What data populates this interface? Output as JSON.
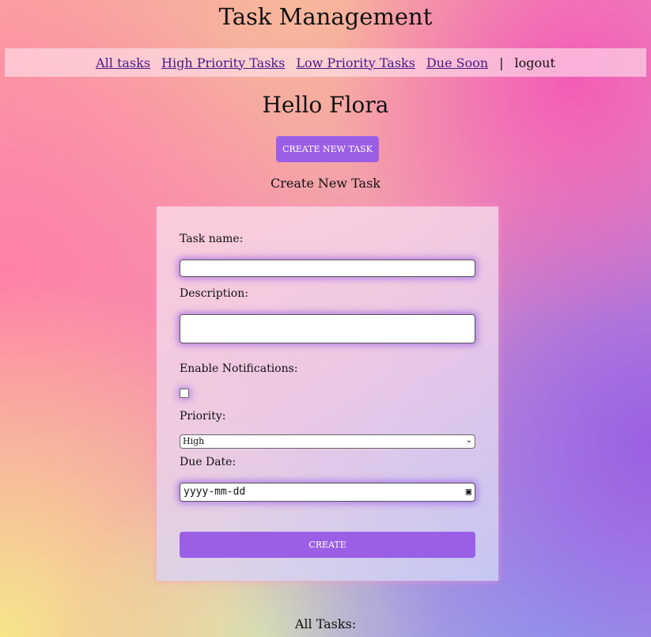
{
  "header": {
    "title": "Task Management"
  },
  "nav": {
    "links": [
      "All tasks",
      "High Priority Tasks",
      "Low Priority Tasks",
      "Due Soon"
    ],
    "separator": "|",
    "logout": "logout"
  },
  "greeting": "Hello Flora",
  "create_new_task_button": "CREATE NEW TASK",
  "form": {
    "heading": "Create New Task",
    "task_name_label": "Task name:",
    "task_name_value": "",
    "description_label": "Description:",
    "description_value": "",
    "notifications_label": "Enable Notifications:",
    "notifications_checked": false,
    "priority_label": "Priority:",
    "priority_value": "High",
    "due_date_label": "Due Date:",
    "due_date_placeholder": "yyyy-mm-dd",
    "submit": "CREATE"
  },
  "all_tasks_heading": "All Tasks:",
  "colors": {
    "accent": "#9b5fe6",
    "link": "#4b1a88"
  }
}
